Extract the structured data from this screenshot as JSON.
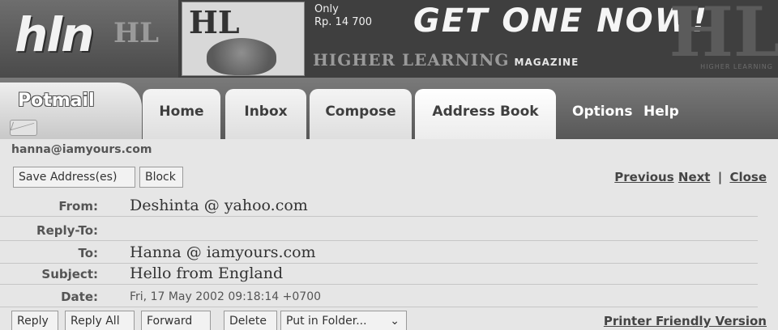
{
  "banner": {
    "logo": "hln",
    "logo_mark": "HL",
    "ad": {
      "cover_mark": "HL",
      "price_line1": "Only",
      "price_line2": "Rp. 14 700",
      "slogan": "GET ONE NOW!",
      "title": "HIGHER LEARNING",
      "title_sub": "MAGAZINE",
      "bg_mark": "HL",
      "bg_sub": "HIGHER LEARNING"
    }
  },
  "nav": {
    "brand": "Potmail",
    "tabs": [
      {
        "label": "Home"
      },
      {
        "label": "Inbox"
      },
      {
        "label": "Compose"
      },
      {
        "label": "Address Book"
      }
    ],
    "links": {
      "options": "Options",
      "help": "Help"
    }
  },
  "message": {
    "account": "hanna@iamyours.com",
    "save_label": "Save Address(es)",
    "block_label": "Block",
    "pager": {
      "previous": "Previous",
      "next": "Next",
      "separator": "|",
      "close": "Close"
    },
    "headers": {
      "from_label": "From:",
      "from_value": "Deshinta @ yahoo.com",
      "replyto_label": "Reply-To:",
      "replyto_value": "",
      "to_label": "To:",
      "to_value": "Hanna @ iamyours.com",
      "subject_label": "Subject:",
      "subject_value": "Hello from England",
      "date_label": "Date:",
      "date_value": "Fri, 17 May 2002 09:18:14 +0700"
    },
    "actions": {
      "reply": "Reply",
      "reply_all": "Reply All",
      "forward": "Forward",
      "delete": "Delete",
      "folder_select": "Put in Folder...",
      "printer": "Printer Friendly Version"
    }
  }
}
